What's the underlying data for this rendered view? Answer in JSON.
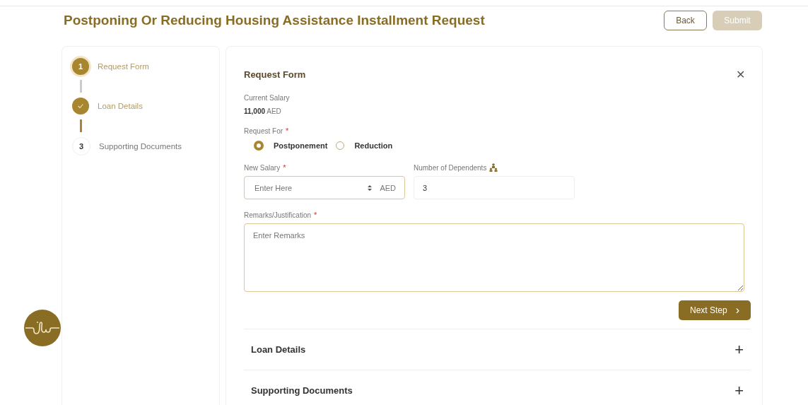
{
  "title": "Postponing Or Reducing Housing Assistance Installment Request",
  "buttons": [
    {
      "label": "Back",
      "disabled": false
    },
    {
      "label": "Submit",
      "disabled": true
    }
  ],
  "steps": [
    {
      "number": "1",
      "label": "Request Form",
      "kind": "current"
    },
    {
      "label": "Loan Details",
      "kind": "done"
    },
    {
      "number": "3",
      "label": "Supporting Documents",
      "kind": "pending"
    }
  ],
  "form": {
    "title": "Request Form",
    "close": "✕",
    "current_salary": {
      "label": "Current Salary",
      "value": "11,000",
      "unit": "AED"
    },
    "request_for": {
      "label": "Request For",
      "required_mark": "*",
      "options": [
        {
          "label": "Postponement",
          "selected": true
        },
        {
          "label": "Reduction",
          "selected": false
        }
      ]
    },
    "new_salary": {
      "label": "New Salary",
      "required_mark": "*",
      "placeholder": "Enter Here",
      "unit": "AED"
    },
    "dependents": {
      "label": "Number of Dependents",
      "value": "3"
    },
    "remarks": {
      "label": "Remarks/Justification",
      "required_mark": "*",
      "placeholder": "Enter Remarks"
    },
    "next": {
      "label": "Next Step",
      "icon": "›"
    }
  },
  "sections": [
    {
      "title": "Loan Details",
      "icon": "+"
    },
    {
      "title": "Supporting Documents",
      "icon": "+"
    }
  ]
}
